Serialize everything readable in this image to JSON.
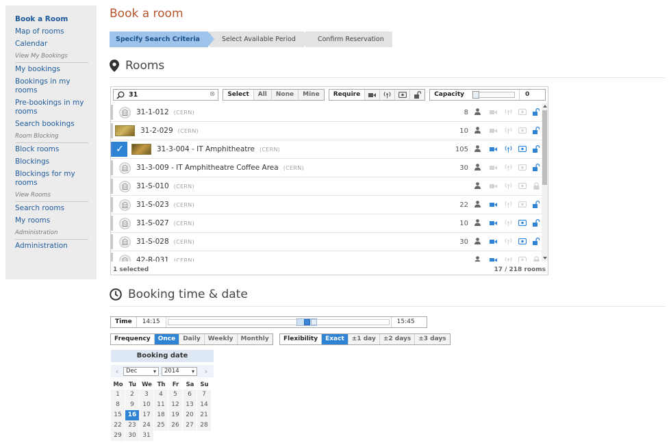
{
  "sidebar": {
    "items": [
      {
        "type": "link",
        "label": "Book a Room",
        "bold": true
      },
      {
        "type": "link",
        "label": "Map of rooms"
      },
      {
        "type": "link",
        "label": "Calendar"
      },
      {
        "type": "section",
        "label": "View My Bookings"
      },
      {
        "type": "link",
        "label": "My bookings"
      },
      {
        "type": "link",
        "label": "Bookings in my rooms"
      },
      {
        "type": "link",
        "label": "Pre-bookings in my rooms"
      },
      {
        "type": "link",
        "label": "Search bookings"
      },
      {
        "type": "section",
        "label": "Room Blocking"
      },
      {
        "type": "link",
        "label": "Block rooms"
      },
      {
        "type": "link",
        "label": "Blockings"
      },
      {
        "type": "link",
        "label": "Blockings for my rooms"
      },
      {
        "type": "section",
        "label": "View Rooms"
      },
      {
        "type": "link",
        "label": "Search rooms"
      },
      {
        "type": "link",
        "label": "My rooms"
      },
      {
        "type": "section",
        "label": "Administration"
      },
      {
        "type": "link",
        "label": "Administration"
      }
    ]
  },
  "page": {
    "title": "Book a room",
    "steps": [
      "Specify Search Criteria",
      "Select Available Period",
      "Confirm Reservation"
    ],
    "rooms_heading": "Rooms",
    "booking_heading": "Booking time & date"
  },
  "filters": {
    "search_value": "31",
    "select_label": "Select",
    "select_options": [
      "All",
      "None",
      "Mine"
    ],
    "require_label": "Require",
    "capacity_label": "Capacity",
    "capacity_value": "0",
    "capacity_fraction": 0
  },
  "rooms": [
    {
      "name": "31-1-012",
      "site": "(CERN)",
      "capacity": "8",
      "thumb": "icon",
      "features": [
        "off",
        "off",
        "off",
        "on"
      ],
      "selected": false
    },
    {
      "name": "31-2-029",
      "site": "(CERN)",
      "capacity": "10",
      "thumb": "photo",
      "features": [
        "off",
        "off",
        "off",
        "on"
      ],
      "selected": false
    },
    {
      "name": "31-3-004 - IT Amphitheatre",
      "site": "(CERN)",
      "capacity": "105",
      "thumb": "photo",
      "features": [
        "on",
        "on",
        "on",
        "on"
      ],
      "selected": true
    },
    {
      "name": "31-3-009 - IT Amphitheatre Coffee Area",
      "site": "(CERN)",
      "capacity": "30",
      "thumb": "icon",
      "features": [
        "off",
        "off",
        "off",
        "on"
      ],
      "selected": false
    },
    {
      "name": "31-S-010",
      "site": "(CERN)",
      "capacity": "",
      "thumb": "icon",
      "features": [
        "off",
        "off",
        "off",
        "locked"
      ],
      "selected": false
    },
    {
      "name": "31-S-023",
      "site": "(CERN)",
      "capacity": "22",
      "thumb": "icon",
      "features": [
        "on",
        "off",
        "off",
        "on"
      ],
      "selected": false
    },
    {
      "name": "31-S-027",
      "site": "(CERN)",
      "capacity": "10",
      "thumb": "icon",
      "features": [
        "on",
        "off",
        "on",
        "on"
      ],
      "selected": false
    },
    {
      "name": "31-S-028",
      "site": "(CERN)",
      "capacity": "30",
      "thumb": "icon",
      "features": [
        "on",
        "off",
        "on",
        "on"
      ],
      "selected": false
    },
    {
      "name": "42-R-031",
      "site": "(CERN)",
      "capacity": "",
      "thumb": "icon",
      "features": [
        "on",
        "off",
        "off",
        "locked"
      ],
      "selected": false
    }
  ],
  "list_footer": {
    "selected": "1 selected",
    "count": "17 / 218 rooms"
  },
  "time": {
    "label": "Time",
    "start": "14:15",
    "end": "15:45"
  },
  "frequency": {
    "label": "Frequency",
    "options": [
      "Once",
      "Daily",
      "Weekly",
      "Monthly"
    ],
    "active": 0
  },
  "flexibility": {
    "label": "Flexibility",
    "options": [
      "Exact",
      "±1 day",
      "±2 days",
      "±3 days"
    ],
    "active": 0
  },
  "calendar": {
    "title": "Booking date",
    "month": "Dec",
    "year": "2014",
    "weekdays": [
      "Mo",
      "Tu",
      "We",
      "Th",
      "Fr",
      "Sa",
      "Su"
    ],
    "days": [
      "1",
      "2",
      "3",
      "4",
      "5",
      "6",
      "7",
      "8",
      "9",
      "10",
      "11",
      "12",
      "13",
      "14",
      "15",
      "16",
      "17",
      "18",
      "19",
      "20",
      "21",
      "22",
      "23",
      "24",
      "25",
      "26",
      "27",
      "28",
      "29",
      "30",
      "31"
    ],
    "today": "16"
  },
  "colors": {
    "accent": "#2f83d5",
    "title": "#b5542b",
    "link": "#1f5b9c"
  }
}
